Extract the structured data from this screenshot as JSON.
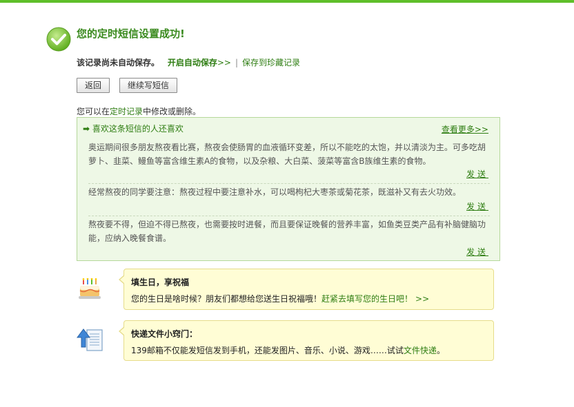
{
  "success": {
    "title": "您的定时短信设置成功!"
  },
  "save_notice": {
    "text": "该记录尚未自动保存。",
    "auto_save_link": "开启自动保存",
    "arrows": ">>",
    "sep": "|",
    "favorite_link": "保存到珍藏记录"
  },
  "buttons": {
    "back": "返回",
    "continue": "继续写短信"
  },
  "tip": {
    "prefix": "您可以在",
    "link": "定时记录",
    "suffix": "中修改或删除。"
  },
  "likes": {
    "header": "喜欢这条短信的人还喜欢",
    "more": "查看更多>>",
    "send_label": "发送",
    "messages": [
      {
        "line1": "奥运期间很多朋友熬夜看比赛，熬夜会使肠胃的血液循环变差，所以不能吃的太饱，并以清淡为主。可多吃胡",
        "line2": "萝卜、韭菜、鳗鱼等富含维生素A的食物，以及杂粮、大白菜、菠菜等富含B族维生素的食物。"
      },
      {
        "line1": "经常熬夜的同学要注意：熬夜过程中要注意补水，可以喝枸杞大枣茶或菊花茶，既滋补又有去火功效。"
      },
      {
        "line1": "熬夜要不得，但迫不得已熬夜，也需要按时进餐，而且要保证晚餐的营养丰富，如鱼类豆类产品有补脑健脑功",
        "line2": "能，应纳入晚餐食谱。"
      }
    ]
  },
  "birthday": {
    "title": "填生日，享祝福",
    "text": "您的生日是啥时候？朋友们都想给您送生日祝福哦！",
    "link": "赶紧去填写您的生日吧！",
    "arrows": ">>"
  },
  "filetip": {
    "title": "快递文件小窍门：",
    "text": "139邮箱不仅能发短信发到手机，还能发图片、音乐、小说、游戏……试试",
    "link": "文件快递",
    "end": "。"
  },
  "colors": {
    "accent": "#2e7d12",
    "success": "#5fbf2a",
    "panel": "#eef8e6",
    "card": "#fffdd5"
  }
}
